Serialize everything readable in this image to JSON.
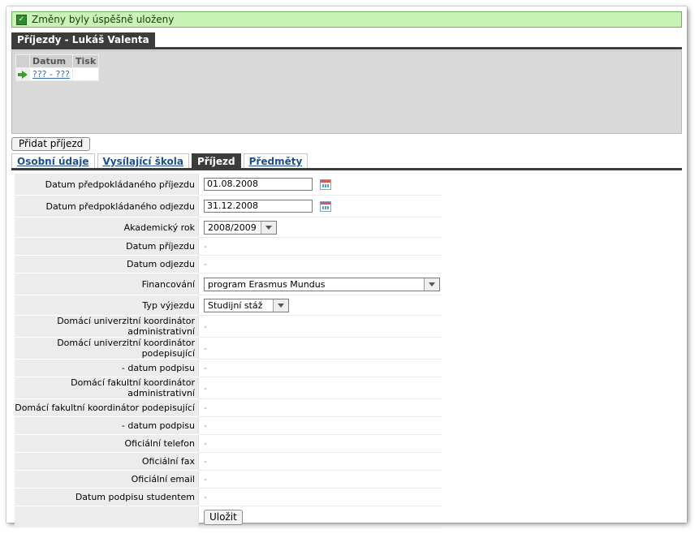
{
  "success_message": "Změny byly úspěšně uloženy",
  "panel_title": "Příjezdy - Lukáš Valenta",
  "grid": {
    "columns": [
      "Datum",
      "Tisk"
    ],
    "rows": [
      {
        "datum": "??? - ???",
        "tisk": ""
      }
    ]
  },
  "add_button": "Přidat příjezd",
  "tabs": [
    {
      "label": "Osobní údaje",
      "active": false
    },
    {
      "label": "Vysílající škola",
      "active": false
    },
    {
      "label": "Příjezd",
      "active": true
    },
    {
      "label": "Předměty",
      "active": false
    }
  ],
  "form": {
    "arrival_expected": {
      "label": "Datum předpokládaného příjezdu",
      "value": "01.08.2008"
    },
    "departure_expected": {
      "label": "Datum předpokládaného odjezdu",
      "value": "31.12.2008"
    },
    "academic_year": {
      "label": "Akademický rok",
      "value": "2008/2009"
    },
    "arrival_date": {
      "label": "Datum příjezdu",
      "value": "-"
    },
    "departure_date": {
      "label": "Datum odjezdu",
      "value": "-"
    },
    "financing": {
      "label": "Financování",
      "value": "program Erasmus Mundus"
    },
    "trip_type": {
      "label": "Typ výjezdu",
      "value": "Studijní stáž"
    },
    "home_uni_admin": {
      "label": "Domácí univerzitní koordinátor administrativní",
      "value": "-"
    },
    "home_uni_signing": {
      "label": "Domácí univerzitní koordinátor podepisující",
      "value": "-"
    },
    "home_uni_sign_date": {
      "label": "- datum podpisu",
      "value": "-"
    },
    "home_fac_admin": {
      "label": "Domácí fakultní koordinátor administrativní",
      "value": "-"
    },
    "home_fac_signing": {
      "label": "Domácí fakultní koordinátor podepisující",
      "value": "-"
    },
    "home_fac_sign_date": {
      "label": "- datum podpisu",
      "value": "-"
    },
    "official_phone": {
      "label": "Oficiální telefon",
      "value": "-"
    },
    "official_fax": {
      "label": "Oficiální fax",
      "value": "-"
    },
    "official_email": {
      "label": "Oficiální email",
      "value": "-"
    },
    "student_sign_date": {
      "label": "Datum podpisu studentem",
      "value": "-"
    },
    "save_button": "Uložit"
  },
  "icons": {
    "success": "check-icon",
    "row_pointer": "arrow-right-icon",
    "calendar": "calendar-icon",
    "dropdown": "chevron-down-icon"
  }
}
